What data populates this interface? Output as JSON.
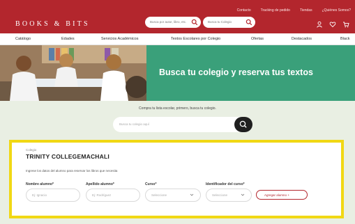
{
  "brand": {
    "logo_text": "BOOKS & BITS",
    "primary": "#b3262d",
    "green": "#3aa07a",
    "highlight": "#f1d814"
  },
  "util_links": [
    "Contacto",
    "Tracking de pedido",
    "Tiendas",
    "¿Quiénes Somos?"
  ],
  "header": {
    "search_placeholder": "Busca por autor, libro, etc.",
    "colegio_placeholder": "Busca tu Colegio",
    "icons": [
      "user-icon",
      "heart-icon",
      "cart-icon"
    ]
  },
  "nav": [
    "Catálogo",
    "Edades",
    "Servicios Académicos",
    "Textos Escolares por Colegio",
    "Ofertas",
    "Destacados",
    "Black"
  ],
  "hero": {
    "title": "Busca tu colegio y reserva tus textos"
  },
  "intro": {
    "text": "Compra tu lista escolar, primero, busca tu colegio.",
    "search_placeholder": "Busca tu colegio aquí"
  },
  "form": {
    "colegio_label": "Colegio",
    "school_name": "TRINITY COLLEGEMACHALI",
    "instructions": "Ingrese los datos del alumno para reservar los libros que necesita",
    "fields": [
      {
        "label": "Nombre alumno*",
        "placeholder": "Ej: Ignacio"
      },
      {
        "label": "Apellido alumno*",
        "placeholder": "Ej: Rodríguez"
      },
      {
        "label": "Curso*",
        "placeholder": "Seleccione"
      },
      {
        "label": "Identificador del curso*",
        "placeholder": "Seleccione"
      }
    ],
    "add_button": "Agregar alumno +"
  }
}
